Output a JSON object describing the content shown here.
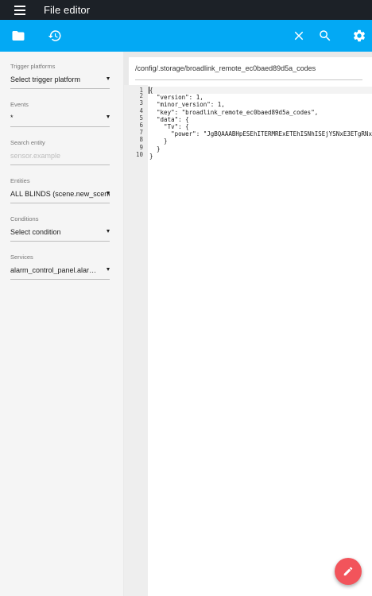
{
  "appbar": {
    "title": "File editor"
  },
  "sidebar": {
    "fields": [
      {
        "label": "Trigger platforms",
        "value": "Select trigger platform"
      },
      {
        "label": "Events",
        "value": "*"
      },
      {
        "label": "Search entity",
        "placeholder": "sensor.example"
      },
      {
        "label": "Entities",
        "value": "ALL BLINDS (scene.new_scene)"
      },
      {
        "label": "Conditions",
        "value": "Select condition"
      },
      {
        "label": "Services",
        "value": "alarm_control_panel.alarm_arm_away"
      }
    ]
  },
  "editor": {
    "file_path": "/config/.storage/broadlink_remote_ec0baed89d5a_codes",
    "line_numbers": [
      "1",
      "2",
      "3",
      "4",
      "5",
      "6",
      "7",
      "8",
      "9",
      "10"
    ],
    "code": "{\n  \"version\": 1,\n  \"minor_version\": 1,\n  \"key\": \"broadlink_remote_ec0baed89d5a_codes\",\n  \"data\": {\n    \"Tv\": {\n      \"power\": \"JgBQAAABHpESEhITERMRExETEhISNhISEjYSNxE3ETgRNx\n    }\n  }\n}"
  },
  "colors": {
    "appbar": "#1c2127",
    "toolbar": "#03a9f4",
    "fab": "#f2545b"
  }
}
